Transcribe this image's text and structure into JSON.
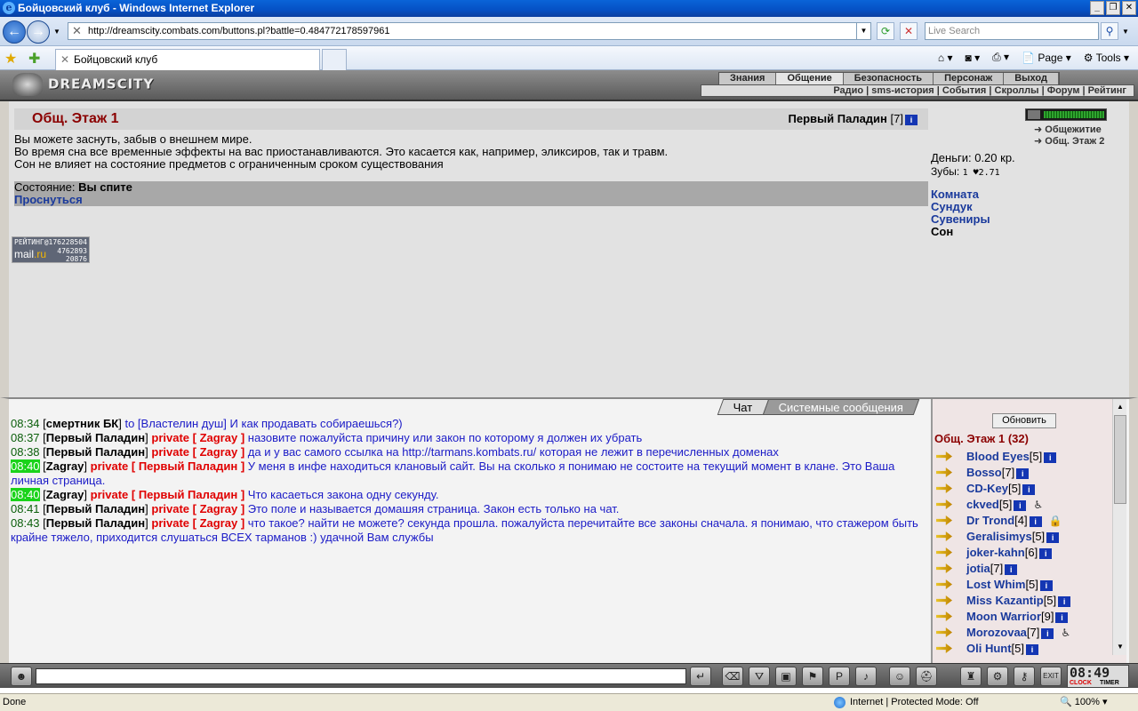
{
  "window": {
    "title": "Бойцовский клуб - Windows Internet Explorer",
    "url": "http://dreamscity.combats.com/buttons.pl?battle=0.484772178597961",
    "search_placeholder": "Live Search",
    "tab_title": "Бойцовский клуб",
    "page_label": "Page",
    "tools_label": "Tools"
  },
  "game": {
    "logo": "DREAMSCITY",
    "menu_top": [
      "Знания",
      "Общение",
      "Безопасность",
      "Персонаж",
      "Выход"
    ],
    "menu_bottom": "Радио | sms-история | События | Скроллы | Форум | Рейтинг",
    "room_title": "Общ. Этаж 1",
    "player_name": "Первый Паладин",
    "player_level": "[7]",
    "description": [
      "Вы можете заснуть, забыв о внешнем мире.",
      "Во время сна все временные эффекты на вас приостанавливаются. Это касается как, например, эликсиров, так и травм.",
      "Сон не влияет на состояние предметов с ограниченным сроком существования"
    ],
    "state_label": "Состояние:",
    "state_value": "Вы спите",
    "wake_link": "Проснуться",
    "counter": {
      "top": "РЕЙТИНГ@176228504",
      "mail": "mail",
      "ru": ".ru",
      "n1": "4762893",
      "n2": "20876"
    },
    "locations": [
      "Общежитие",
      "Общ. Этаж 2"
    ],
    "money": "Деньги: 0.20 кр.",
    "teeth_label": "Зубы:",
    "teeth_value": "1 ♥2.71",
    "room_links": [
      "Комната",
      "Сундук",
      "Сувениры",
      "Сон"
    ]
  },
  "chat": {
    "tabs": [
      "Чат",
      "Системные сообщения"
    ],
    "lines": [
      {
        "ts": "08:34",
        "hl": false,
        "nick": "смертник БК",
        "pre": "to [Властелин душ]",
        "priv": "",
        "msg": "И как продавать собираешься?)"
      },
      {
        "ts": "08:37",
        "hl": false,
        "nick": "Первый Паладин",
        "pre": "",
        "priv": "private [ Zagray ]",
        "msg": "назовите пожалуйста причину или закон по которому я должен их убрать"
      },
      {
        "ts": "08:38",
        "hl": false,
        "nick": "Первый Паладин",
        "pre": "",
        "priv": "private [ Zagray ]",
        "msg": "да и у вас самого ссылка на http://tarmans.kombats.ru/ которая не лежит в перечисленных доменах"
      },
      {
        "ts": "08:40",
        "hl": true,
        "nick": "Zagray",
        "pre": "",
        "priv": "private [ Первый Паладин ]",
        "msg": "У меня в инфе находиться клановый сайт. Вы на сколько я понимаю не состоите на текущий момент в клане. Это Ваша личная страница."
      },
      {
        "ts": "08:40",
        "hl": true,
        "nick": "Zagray",
        "pre": "",
        "priv": "private [ Первый Паладин ]",
        "msg": "Что касаеться закона одну секунду."
      },
      {
        "ts": "08:41",
        "hl": false,
        "nick": "Первый Паладин",
        "pre": "",
        "priv": "private [ Zagray ]",
        "msg": "Это поле и называется домашяя страница. Закон есть только на чат."
      },
      {
        "ts": "08:43",
        "hl": false,
        "nick": "Первый Паладин",
        "pre": "",
        "priv": "private [ Zagray ]",
        "msg": "что такое? найти не можете? секунда прошла. пожалуйста перечитайте все законы сначала. я понимаю, что стажером быть крайне тяжело, приходится слушаться ВСЕХ тарманов :) удачной Вам службы"
      }
    ]
  },
  "userlist": {
    "refresh": "Обновить",
    "title": "Общ. Этаж 1 (32)",
    "users": [
      {
        "name": "Blood Eyes",
        "lvl": "[5]",
        "extra": ""
      },
      {
        "name": "Bosso",
        "lvl": "[7]",
        "extra": ""
      },
      {
        "name": "CD-Key",
        "lvl": "[5]",
        "extra": ""
      },
      {
        "name": "ckved",
        "lvl": "[5]",
        "extra": "♿"
      },
      {
        "name": "Dr Trond",
        "lvl": "[4]",
        "extra": "🔒"
      },
      {
        "name": "Geralisimys",
        "lvl": "[5]",
        "extra": ""
      },
      {
        "name": "joker-kahn",
        "lvl": "[6]",
        "extra": ""
      },
      {
        "name": "jotia",
        "lvl": "[7]",
        "extra": ""
      },
      {
        "name": "Lost Whim",
        "lvl": "[5]",
        "extra": ""
      },
      {
        "name": "Miss Kazantip",
        "lvl": "[5]",
        "extra": ""
      },
      {
        "name": "Moon Warrior",
        "lvl": "[9]",
        "extra": ""
      },
      {
        "name": "Morozovaa",
        "lvl": "[7]",
        "extra": "♿"
      },
      {
        "name": "Oli Hunt",
        "lvl": "[5]",
        "extra": ""
      }
    ]
  },
  "bottombar": {
    "clock_time": "08:49",
    "clock_label": "CLOCK",
    "timer_label": "TIMER",
    "enter_icon": "enter-icon"
  },
  "statusbar": {
    "left": "Done",
    "zone": "Internet | Protected Mode: Off",
    "zoom": "100%"
  },
  "colors": {
    "room_title": "#8b0000",
    "link": "#1a3a9c",
    "private": "#e00000",
    "message": "#1b1bc7",
    "timestamp": "#0a5e0a",
    "highlight": "#1ad31a"
  }
}
